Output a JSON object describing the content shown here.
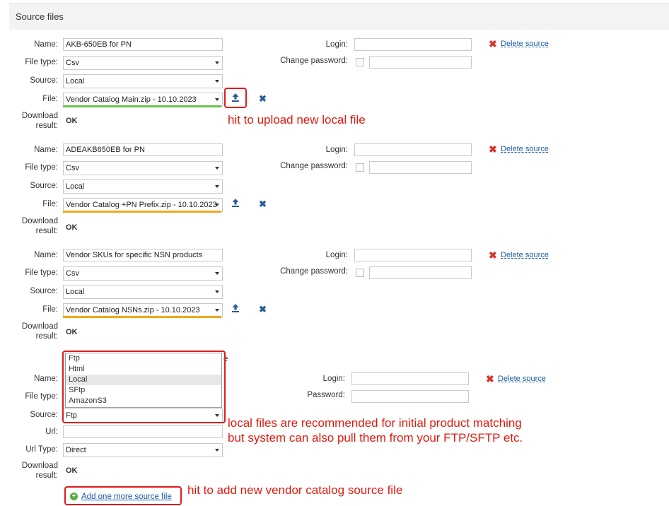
{
  "header": {
    "title": "Source files"
  },
  "labels": {
    "name": "Name:",
    "file_type": "File type:",
    "source": "Source:",
    "file": "File:",
    "download": "Download",
    "result": "result:",
    "login": "Login:",
    "change_password": "Change password:",
    "password": "Password:",
    "url": "Url:",
    "url_type": "Url Type:",
    "delete_source": "Delete source"
  },
  "sources": [
    {
      "name": "AKB-650EB for PN",
      "file_type": "Csv",
      "source": "Local",
      "file": "Vendor Catalog Main.zip  -  10.10.2023",
      "result": "OK"
    },
    {
      "name": "ADEAKB650EB for PN",
      "file_type": "Csv",
      "source": "Local",
      "file": "Vendor Catalog +PN Prefix.zip  -  10.10.2023",
      "result": "OK"
    },
    {
      "name": "Vendor SKUs for specific NSN products",
      "file_type": "Csv",
      "source": "Local",
      "file": "Vendor Catalog NSNs.zip  -  10.10.2023",
      "result": "OK"
    },
    {
      "source": "Ftp",
      "url": "",
      "url_type": "Direct",
      "result": "OK"
    }
  ],
  "dropdown_options": [
    "Ftp",
    "Html",
    "Local",
    "SFtp",
    "AmazonS3"
  ],
  "dropdown_highlighted": "Local",
  "add_link": "Add one more source file",
  "annotations": {
    "upload": "hit to upload new local file",
    "local_line1": "local files are recommended for initial product matching",
    "local_line2": "but system can also pull them from your FTP/SFTP etc.",
    "add": "hit to add new vendor catalog source file"
  },
  "colors": {
    "annotation_red": "#e0190f",
    "link_blue": "#1a5aa6",
    "green_underline": "#6cc24a",
    "orange_underline": "#f0a81c"
  }
}
